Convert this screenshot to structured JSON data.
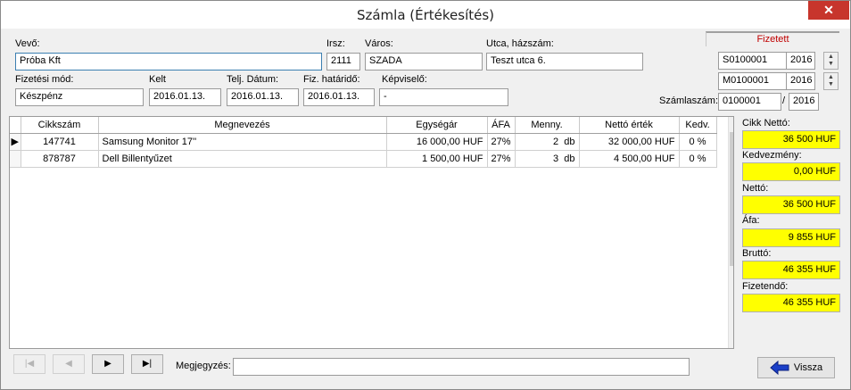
{
  "window": {
    "title": "Számla (Értékesítés)",
    "close_glyph": "✕"
  },
  "header": {
    "vevo_label": "Vevő:",
    "vevo_value": "Próba Kft",
    "irsz_label": "Irsz:",
    "irsz_value": "2111",
    "varos_label": "Város:",
    "varos_value": "SZADA",
    "utca_label": "Utca, házszám:",
    "utca_value": "Teszt utca 6.",
    "fizmod_label": "Fizetési mód:",
    "fizmod_value": "Készpénz",
    "kelt_label": "Kelt",
    "kelt_value": "2016.01.13.",
    "telj_label": "Telj. Dátum:",
    "telj_value": "2016.01.13.",
    "hatarido_label": "Fiz. határidő:",
    "hatarido_value": "2016.01.13.",
    "kepviselo_label": "Képviselő:",
    "kepviselo_value": "-"
  },
  "right_panel": {
    "status": "Fizetett",
    "series1_code": "S0100001",
    "series1_year": "2016",
    "series2_code": "M0100001",
    "series2_year": "2016",
    "szamlaszam_label": "Számlaszám:",
    "szamlaszam_value": "0100001",
    "slash": "/",
    "szamlaszam_year": "2016"
  },
  "grid": {
    "columns": [
      "Cikkszám",
      "Megnevezés",
      "Egységár",
      "ÁFA",
      "Menny.",
      "Nettó érték",
      "Kedv."
    ],
    "rows": [
      {
        "cikkszam": "147741",
        "megnevezes": "Samsung Monitor 17''",
        "egysegar": "16 000,00 HUF",
        "afa": "27%",
        "menny": "2",
        "unit": "db",
        "netto": "32 000,00 HUF",
        "kedv": "0 %"
      },
      {
        "cikkszam": "878787",
        "megnevezes": "Dell Billentyűzet",
        "egysegar": "1 500,00 HUF",
        "afa": "27%",
        "menny": "3",
        "unit": "db",
        "netto": "4 500,00 HUF",
        "kedv": "0 %"
      }
    ]
  },
  "summary": {
    "cikk_netto_label": "Cikk Nettó:",
    "cikk_netto": "36 500 HUF",
    "kedvezmeny_label": "Kedvezmény:",
    "kedvezmeny": "0,00 HUF",
    "netto_label": "Nettó:",
    "netto": "36 500 HUF",
    "afa_label": "Áfa:",
    "afa": "9 855 HUF",
    "brutto_label": "Bruttó:",
    "brutto": "46 355 HUF",
    "fizetendo_label": "Fizetendő:",
    "fizetendo": "46 355 HUF"
  },
  "footer": {
    "megjegyzes_label": "Megjegyzés:",
    "megjegyzes_value": "",
    "back_label": "Vissza",
    "nav_first": "|◀",
    "nav_prev": "◀",
    "nav_next": "▶",
    "nav_last": "▶|"
  },
  "colors": {
    "highlight": "#ffff00",
    "status": "#c00000",
    "arrow": "#1a3fc8"
  }
}
